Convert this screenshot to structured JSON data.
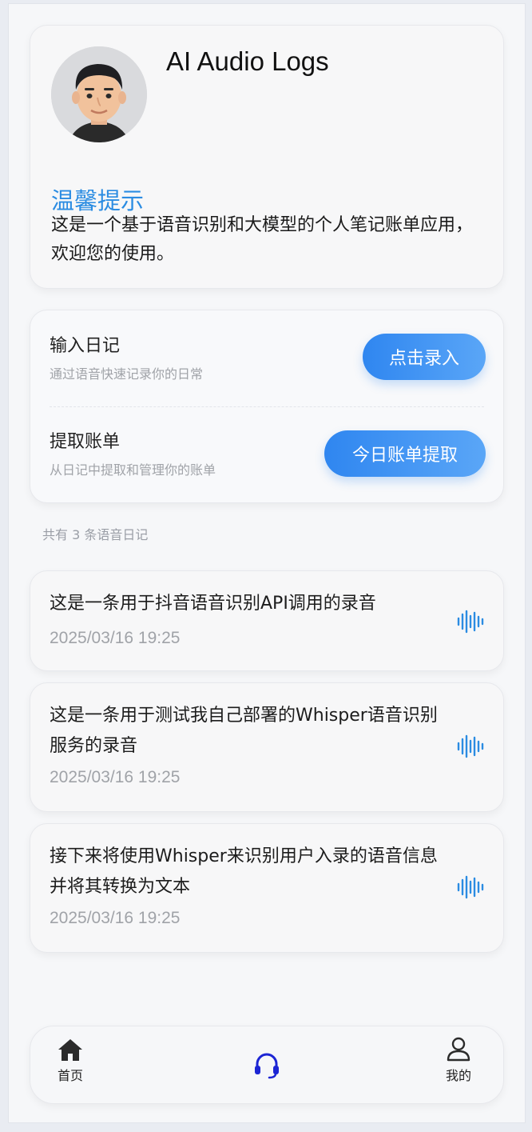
{
  "profile": {
    "title": "AI Audio Logs",
    "tip_title": "温馨提示",
    "tip_body": "这是一个基于语音识别和大模型的个人笔记账单应用，欢迎您的使用。"
  },
  "actions": {
    "diary": {
      "title": "输入日记",
      "subtitle": "通过语音快速记录你的日常",
      "button": "点击录入"
    },
    "bill": {
      "title": "提取账单",
      "subtitle": "从日记中提取和管理你的账单",
      "button": "今日账单提取"
    }
  },
  "log_count_text": "共有 3 条语音日记",
  "logs": [
    {
      "text": "这是一条用于抖音语音识别API调用的录音",
      "time": "2025/03/16 19:25"
    },
    {
      "text": "这是一条用于测试我自己部署的Whisper语音识别服务的录音",
      "time": "2025/03/16 19:25"
    },
    {
      "text": "接下来将使用Whisper来识别用户入录的语音信息 并将其转换为文本",
      "time": "2025/03/16 19:25"
    }
  ],
  "nav": {
    "home_label": "首页",
    "center_icon": "headset-icon",
    "me_label": "我的"
  },
  "colors": {
    "accent": "#2b8ce2",
    "button_gradient_start": "#2f86f0",
    "button_gradient_end": "#5aa6f7",
    "center_icon": "#1c25d4"
  }
}
